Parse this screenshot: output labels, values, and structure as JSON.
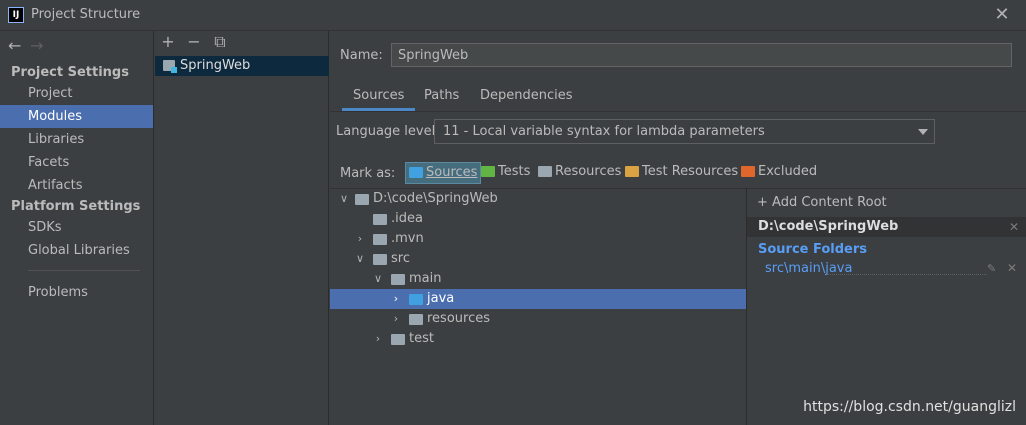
{
  "window": {
    "title": "Project Structure",
    "app_icon": "IJ",
    "close": "✕"
  },
  "nav": {
    "back": "←",
    "forward": "→"
  },
  "sidebar": {
    "project_settings_header": "Project Settings",
    "project_items": [
      {
        "label": "Project"
      },
      {
        "label": "Modules",
        "selected": true
      },
      {
        "label": "Libraries"
      },
      {
        "label": "Facets"
      },
      {
        "label": "Artifacts"
      }
    ],
    "platform_settings_header": "Platform Settings",
    "platform_items": [
      {
        "label": "SDKs"
      },
      {
        "label": "Global Libraries"
      }
    ],
    "problems": "Problems"
  },
  "modules": {
    "toolbar": {
      "add": "+",
      "remove": "−",
      "copy": "⧉"
    },
    "items": [
      {
        "label": "SpringWeb"
      }
    ]
  },
  "main": {
    "name_label": "Name:",
    "name_value": "SpringWeb",
    "tabs": [
      "Sources",
      "Paths",
      "Dependencies"
    ],
    "active_tab": "Sources",
    "language_level_label": "Language level:",
    "language_level_value": "11 - Local variable syntax for lambda parameters",
    "mark_as_label": "Mark as:",
    "mark_as": {
      "sources": "Sources",
      "tests": "Tests",
      "resources": "Resources",
      "test_resources": "Test Resources",
      "excluded": "Excluded"
    },
    "colors": {
      "sources": "#40a0e0",
      "tests": "#62b543",
      "resources": "#9aa7b0",
      "test_resources": "#d9a343",
      "excluded": "#e0672b",
      "selection": "#4b6eaf",
      "link": "#589df6"
    }
  },
  "tree": {
    "rows": [
      {
        "label": "D:\\code\\SpringWeb",
        "chevron": "∨"
      },
      {
        "label": ".idea",
        "chevron": ""
      },
      {
        "label": ".mvn",
        "chevron": "›"
      },
      {
        "label": "src",
        "chevron": "∨"
      },
      {
        "label": "main",
        "chevron": "∨"
      },
      {
        "label": "java",
        "chevron": "›",
        "selected": true
      },
      {
        "label": "resources",
        "chevron": "›"
      },
      {
        "label": "test",
        "chevron": "›"
      }
    ]
  },
  "content_root": {
    "add_label": "Add Content Root",
    "root_path": "D:\\code\\SpringWeb",
    "source_folders_header": "Source Folders",
    "source_folders": [
      "src\\main\\java"
    ]
  },
  "watermark": "https://blog.csdn.net/guanglizl"
}
